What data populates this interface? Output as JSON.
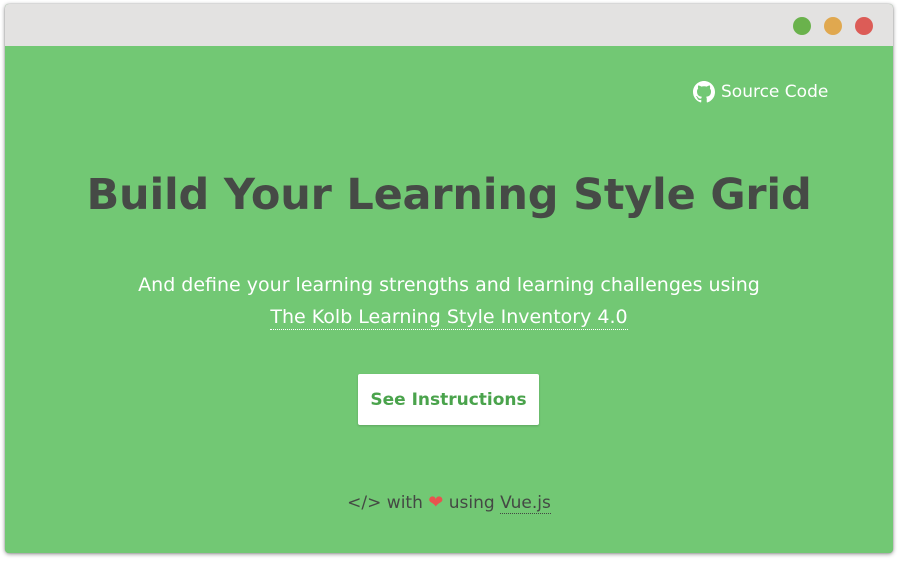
{
  "window": {
    "controls": [
      "maximize",
      "minimize",
      "close"
    ],
    "colors": {
      "titlebar": "#e3e2e1",
      "green_dot": "#6ab24c",
      "yellow_dot": "#e0a84f",
      "red_dot": "#dc5c57",
      "background": "#72c874"
    }
  },
  "header": {
    "source_link_label": "Source Code",
    "source_icon": "github-icon"
  },
  "hero": {
    "title": "Build Your Learning Style Grid",
    "subtitle": "And define your learning strengths and learning challenges using",
    "subtitle_link": "The Kolb Learning Style Inventory 4.0",
    "button_label": "See Instructions"
  },
  "footer": {
    "code_glyph": "</>",
    "with_text": "with",
    "heart_glyph": "❤",
    "using_text": "using",
    "vue_link": "Vue.js",
    "heart_color": "#e8534f"
  }
}
